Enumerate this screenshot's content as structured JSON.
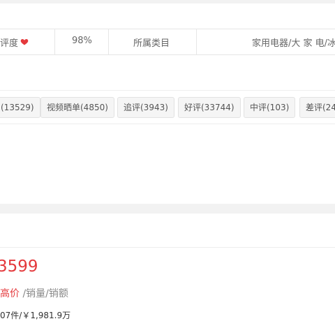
{
  "info_table": {
    "rating_label": "评度",
    "rating_value": "98%",
    "category_label": "所属类目",
    "category_value": "家用电器/大 家 电/冰"
  },
  "review_tags": [
    {
      "label": "(13529)"
    },
    {
      "label": "视频晒单(4850)"
    },
    {
      "label": "追评(3943)"
    },
    {
      "label": "好评(33744)"
    },
    {
      "label": "中评(103)"
    },
    {
      "label": "差评(24"
    }
  ],
  "price_section": {
    "price": "3599",
    "subtitle_highlight": "高价",
    "subtitle_rest": " /销量/销额",
    "sales_summary": "07件/￥1,981.9万"
  },
  "colors": {
    "accent": "#e4393c",
    "heart": "#e4393c",
    "band": "#f2f2f2",
    "tag_bg": "#f5f5f5"
  },
  "icons": {
    "rating": "heart-icon"
  }
}
